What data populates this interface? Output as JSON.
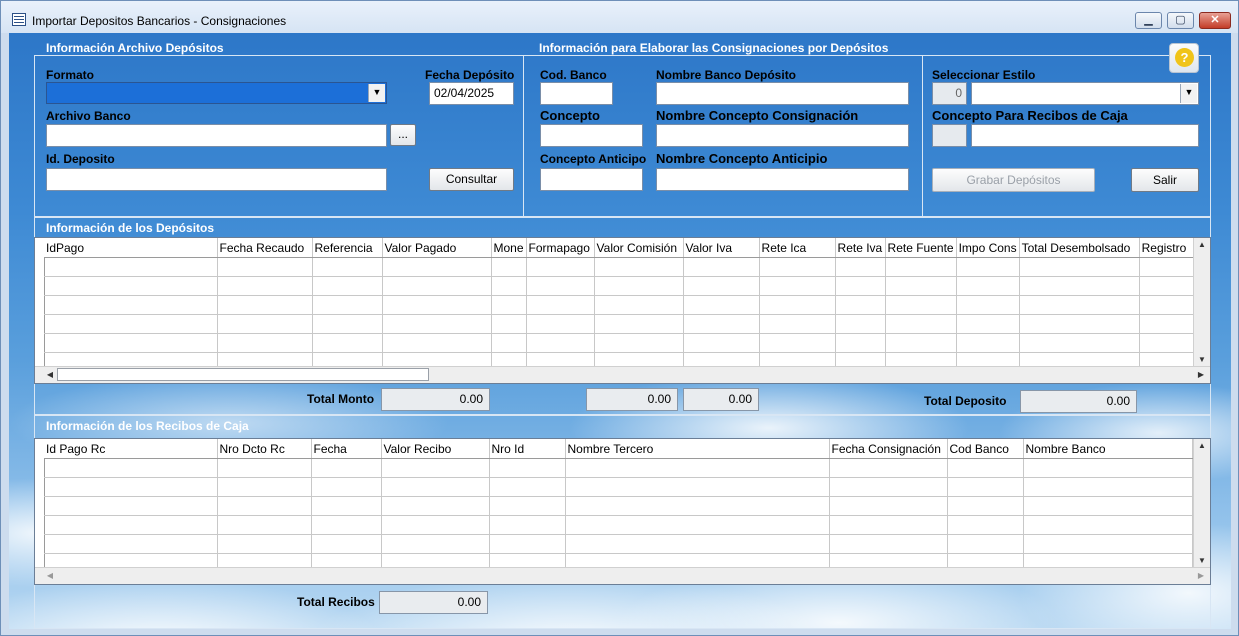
{
  "window": {
    "title": "Importar Depositos Bancarios - Consignaciones",
    "minimize": "▁",
    "maximize": "▢",
    "close": "✕"
  },
  "archivo": {
    "section_title": "Información Archivo Depósitos",
    "formato_label": "Formato",
    "formato_value": "",
    "fecha_label": "Fecha Depósito",
    "fecha_value": "02/04/2025",
    "archivo_label": "Archivo Banco",
    "archivo_value": "",
    "browse_label": "...",
    "id_label": "Id. Deposito",
    "id_value": "",
    "consultar_label": "Consultar"
  },
  "consignaciones": {
    "section_title": "Información para Elaborar las Consignaciones por Depósitos",
    "cod_banco_label": "Cod. Banco",
    "nombre_banco_label": "Nombre Banco Depósito",
    "concepto_label": "Concepto",
    "nombre_concepto_label": "Nombre Concepto Consignación",
    "concepto_anticipo_label": "Concepto Anticipo",
    "nombre_anticipo_label": "Nombre Concepto Anticipio"
  },
  "estilo": {
    "seleccionar_label": "Seleccionar Estilo",
    "estilo_code": "0",
    "concepto_recibos_label": "Concepto Para Recibos de Caja",
    "grabar_label": "Grabar Depósitos",
    "salir_label": "Salir",
    "help": "?"
  },
  "depositos": {
    "section_title": "Información de los Depósitos",
    "columns": [
      "IdPago",
      "Fecha Recaudo",
      "Referencia",
      "Valor Pagado",
      "Mone",
      "Formapago",
      "Valor Comisión",
      "Valor Iva",
      "Rete Ica",
      "Rete Iva",
      "Rete Fuente",
      "Impo Cons",
      "Total Desembolsado",
      "Registro"
    ],
    "total_monto_label": "Total Monto",
    "total_monto": "0.00",
    "total_comision": "0.00",
    "total_iva": "0.00",
    "total_deposito_label": "Total Deposito",
    "total_deposito": "0.00"
  },
  "recibos": {
    "section_title": "Información de los Recibos de Caja",
    "columns": [
      "Id Pago Rc",
      "Nro Dcto Rc",
      "Fecha",
      "Valor Recibo",
      "Nro Id",
      "Nombre Tercero",
      "Fecha Consignación",
      "Cod Banco",
      "Nombre Banco"
    ],
    "total_recibos_label": "Total Recibos",
    "total_recibos": "0.00"
  }
}
